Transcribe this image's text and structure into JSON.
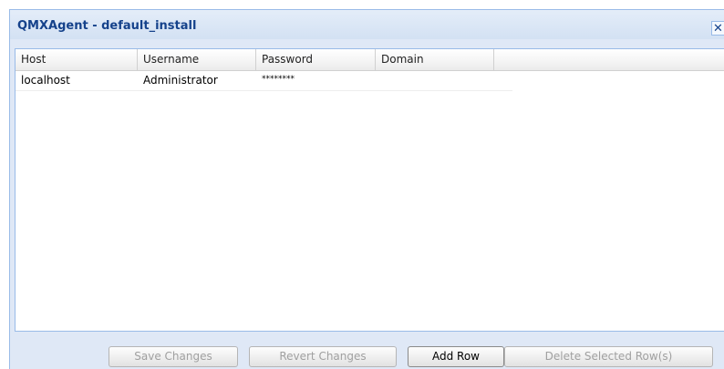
{
  "window": {
    "title": "QMXAgent - default_install",
    "close_glyph": "✕"
  },
  "grid": {
    "columns": [
      "Host",
      "Username",
      "Password",
      "Domain"
    ],
    "rows": [
      {
        "host": "localhost",
        "username": "Administrator",
        "password": "********",
        "domain": ""
      }
    ]
  },
  "footer": {
    "save_label": "Save Changes",
    "revert_label": "Revert Changes",
    "add_label": "Add Row",
    "delete_label": "Delete Selected Row(s)"
  },
  "colors": {
    "window_bg": "#dfe8f6",
    "title_text": "#15428b",
    "border": "#99bbe8",
    "disabled_text": "#a0a0a0"
  }
}
